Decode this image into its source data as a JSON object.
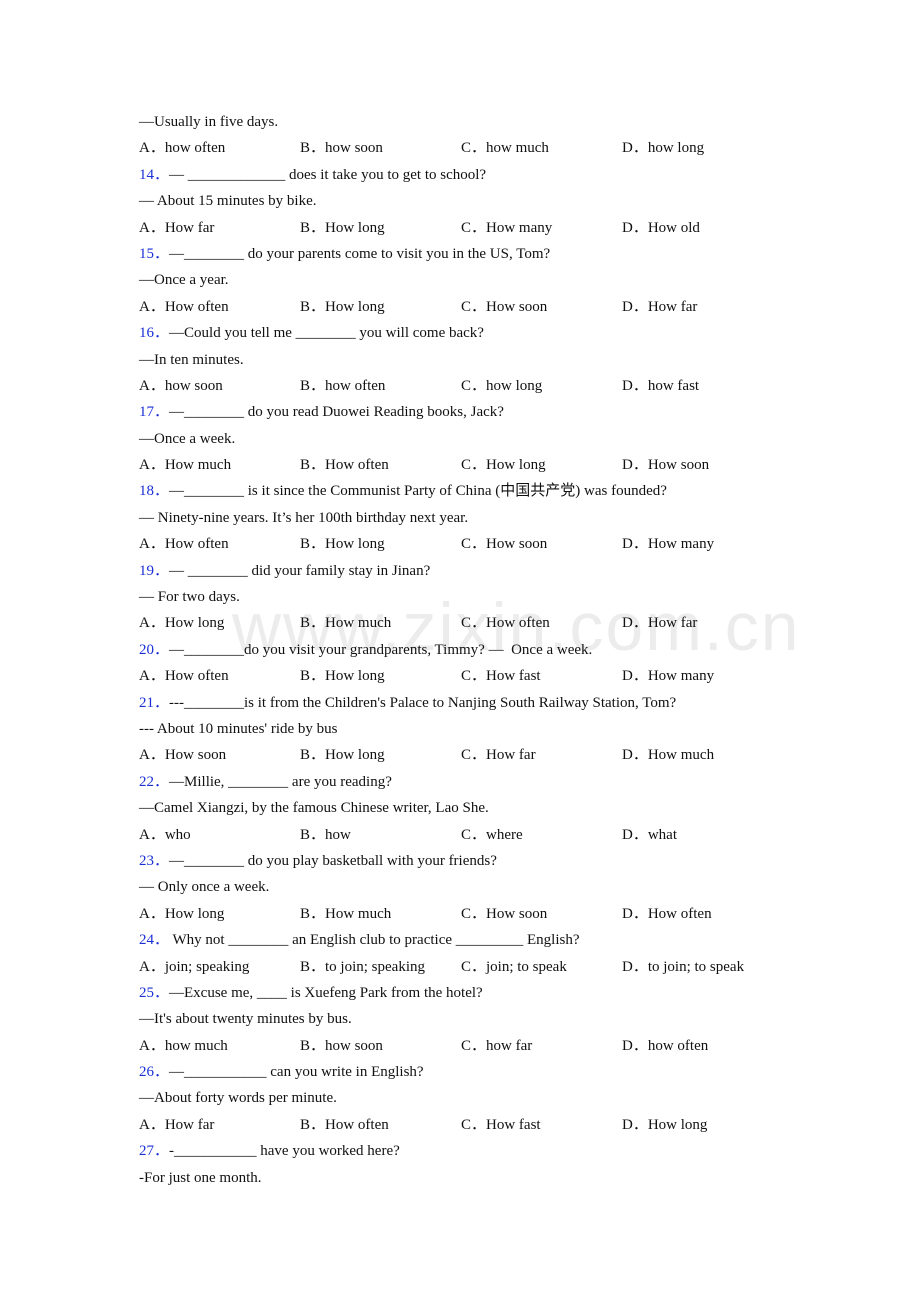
{
  "watermark": "www.zixin.com.cn",
  "lead": {
    "answer": "—Usually in five days.",
    "options": [
      "A．how often",
      "B．how soon",
      "C．how much",
      "D．how long"
    ]
  },
  "questions": [
    {
      "num": "14．",
      "prompt": "— _____________ does it take you to get to school?",
      "answer": "— About 15 minutes by bike.",
      "options": [
        "A．How far",
        "B．How long",
        "C．How many",
        "D．How old"
      ]
    },
    {
      "num": "15．",
      "prompt": "—________ do your parents come to visit you in the US, Tom?",
      "answer": "—Once a year.",
      "options": [
        "A．How often",
        "B．How long",
        "C．How soon",
        "D．How far"
      ]
    },
    {
      "num": "16．",
      "prompt": "—Could you tell me ________ you will come back?",
      "answer": "—In ten minutes.",
      "options": [
        "A．how soon",
        "B．how often",
        "C．how long",
        "D．how fast"
      ]
    },
    {
      "num": "17．",
      "prompt": "—________ do you read Duowei Reading books, Jack?",
      "answer": "—Once a week.",
      "options": [
        "A．How much",
        "B．How often",
        "C．How long",
        "D．How soon"
      ]
    },
    {
      "num": "18．",
      "prompt": "—________ is it since the Communist Party of China (中国共产党) was founded?",
      "answer": "— Ninety-nine years. It’s her 100th birthday next year.",
      "options": [
        "A．How often",
        "B．How long",
        "C．How soon",
        "D．How many"
      ]
    },
    {
      "num": "19．",
      "prompt": "— ________ did your family stay in Jinan?",
      "answer": "— For two days.",
      "options": [
        "A．How long",
        "B．How much",
        "C．How often",
        "D．How far"
      ]
    },
    {
      "num": "20．",
      "prompt": "—________do you visit your grandparents, Timmy? —  Once a week.",
      "answer": null,
      "options": [
        "A．How often",
        "B．How long",
        "C．How fast",
        "D．How many"
      ]
    },
    {
      "num": "21．",
      "prompt": "---________is it from the Children's Palace to Nanjing South Railway Station, Tom?",
      "answer": "--- About 10 minutes' ride by bus",
      "options": [
        "A．How soon",
        "B．How long",
        "C．How far",
        "D．How much"
      ]
    },
    {
      "num": "22．",
      "prompt": "—Millie, ________ are you reading?",
      "answer": "—Camel Xiangzi, by the famous Chinese writer, Lao She.",
      "options": [
        "A．who",
        "B．how",
        "C．where",
        "D．what"
      ]
    },
    {
      "num": "23．",
      "prompt": "—________ do you play basketball with your friends?",
      "answer": "— Only once a week.",
      "options": [
        "A．How long",
        "B．How much",
        "C．How soon",
        "D．How often"
      ]
    },
    {
      "num": "24．",
      "prompt": " Why not ________ an English club to practice _________ English?",
      "answer": null,
      "options": [
        "A．join; speaking",
        "B．to join; speaking",
        "C．join; to speak",
        "D．to join; to speak"
      ]
    },
    {
      "num": "25．",
      "prompt": "—Excuse me, ____ is Xuefeng Park from the hotel?",
      "answer": "—It's about twenty minutes by bus.",
      "options": [
        "A．how much",
        "B．how soon",
        "C．how far",
        "D．how often"
      ]
    },
    {
      "num": "26．",
      "prompt": "—___________ can you write in English?",
      "answer": "—About forty words per minute.",
      "options": [
        "A．How far",
        "B．How often",
        "C．How fast",
        "D．How long"
      ]
    },
    {
      "num": "27．",
      "prompt": "-___________ have you worked here?",
      "answer": "-For just one month.",
      "options": null
    }
  ]
}
